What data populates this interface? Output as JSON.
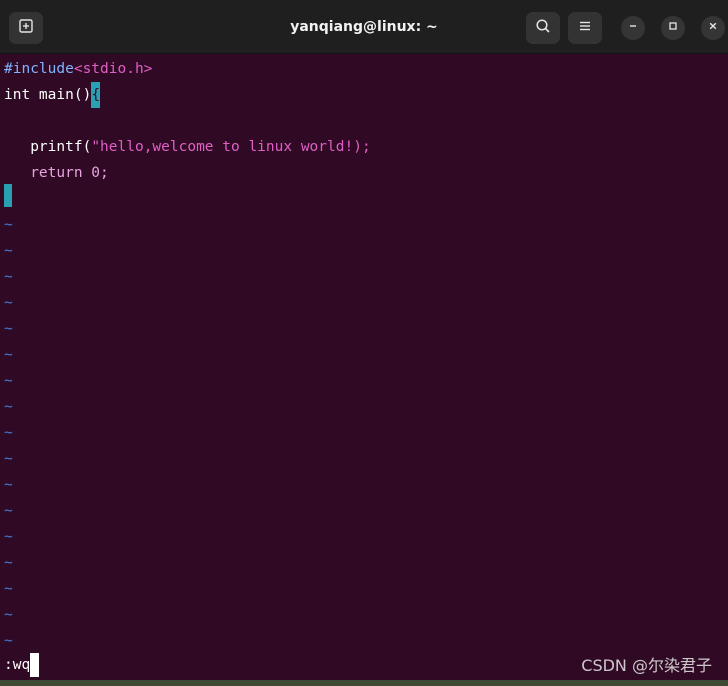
{
  "window": {
    "title": "yanqiang@linux: ~"
  },
  "titlebar": {
    "new_tab_icon": "new-tab-icon",
    "search_icon": "search-icon",
    "menu_icon": "hamburger-menu-icon",
    "minimize_icon": "minimize-icon",
    "maximize_icon": "maximize-icon",
    "close_icon": "close-icon"
  },
  "editor": {
    "lines": {
      "l1_directive": "#include",
      "l1_header": "<stdio.h>",
      "l2_type": "int main()",
      "l2_brace": "{",
      "l4_indent": "   ",
      "l4_func": "printf(",
      "l4_string": "\"hello,welcome to linux world!",
      "l4_tail": ");",
      "l5_indent": "   ",
      "l5_return": "return 0;"
    },
    "tilde": "~",
    "command": ":wq"
  },
  "watermark": "CSDN @尔染君子",
  "colors": {
    "background": "#300a24",
    "titlebar": "#1f1f1f",
    "cursor": "#2aa1b3",
    "tilde": "#3f7dd6",
    "string": "#e05ec6"
  }
}
